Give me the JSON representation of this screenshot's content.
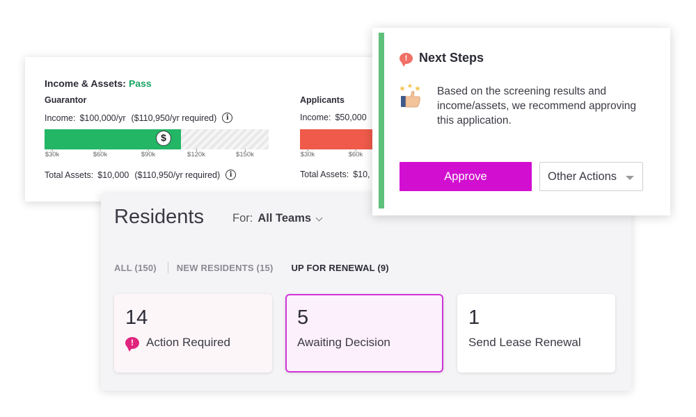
{
  "income_assets": {
    "title": "Income & Assets:",
    "status": "Pass",
    "colors": {
      "pass": "#1aa664",
      "green_bar": "#22b665",
      "red_bar": "#ef5a4a"
    },
    "guarantor": {
      "heading": "Guarantor",
      "income_label": "Income:",
      "income_value": "$100,000/yr",
      "income_required": "($110,950/yr required)",
      "income_fill_fraction": 0.61,
      "dollar_marker_fraction": 0.53,
      "dollar_symbol": "$",
      "ticks": [
        "$30k",
        "$60k",
        "$90k",
        "$120k",
        "$150k"
      ],
      "assets_label": "Total Assets:",
      "assets_value": "$10,000",
      "assets_required": "($110,950/yr required)",
      "info_icon": "info-icon"
    },
    "applicants": {
      "heading": "Applicants",
      "income_label": "Income:",
      "income_value": "$50,000",
      "ticks": [
        "$30k",
        "$60k"
      ],
      "assets_label": "Total Assets:",
      "assets_value": "$10,"
    }
  },
  "residents": {
    "title": "Residents",
    "for_label": "For:",
    "team": "All Teams",
    "tabs": [
      {
        "label": "ALL (150)"
      },
      {
        "label": "NEW RESIDENTS (15)"
      },
      {
        "label": "UP FOR RENEWAL (9)"
      }
    ],
    "stats": [
      {
        "count": "14",
        "label": "Action Required",
        "icon": "alert-bubble-icon"
      },
      {
        "count": "5",
        "label": "Awaiting Decision"
      },
      {
        "count": "1",
        "label": "Send Lease Renewal"
      }
    ],
    "accent": "#d034d8"
  },
  "next_steps": {
    "title": "Next Steps",
    "icon": "alert-bubble-icon",
    "emoji": "stars-thumbs-up-icon",
    "message": "Based on the screening results and income/assets, we recommend approving this application.",
    "approve_label": "Approve",
    "other_actions_label": "Other Actions",
    "colors": {
      "approve": "#d20fd0",
      "stripe": "#5ec07a"
    }
  }
}
